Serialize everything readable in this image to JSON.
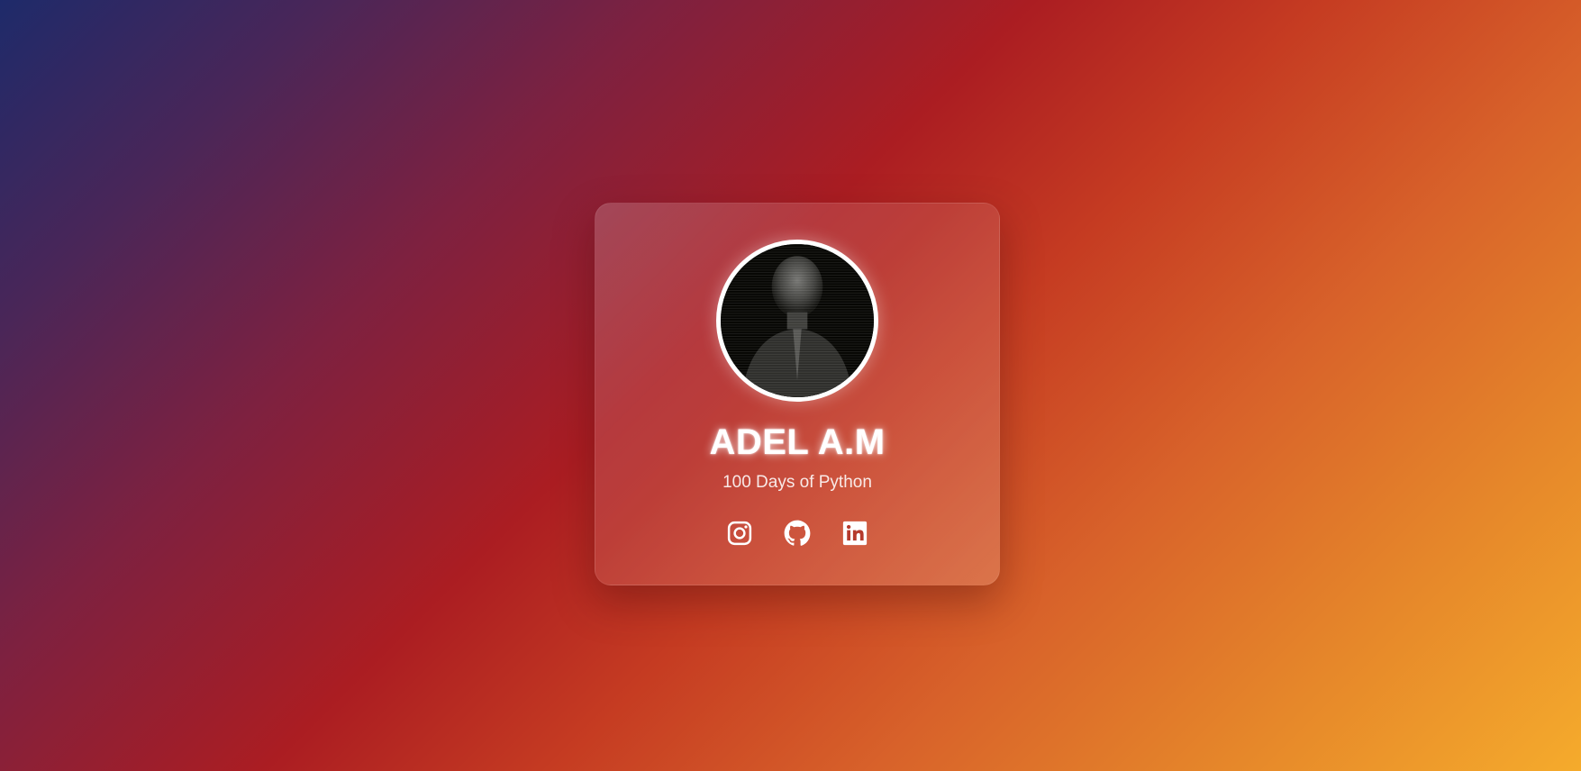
{
  "profile": {
    "name": "ADEL A.M",
    "subtitle": "100 Days of Python"
  },
  "socials": [
    {
      "icon": "instagram-icon"
    },
    {
      "icon": "github-icon"
    },
    {
      "icon": "linkedin-icon"
    }
  ],
  "colors": {
    "gradient_start": "#1e2a6a",
    "gradient_mid": "#ab1d22",
    "gradient_end": "#f5ab2c",
    "text": "#ffffff"
  }
}
